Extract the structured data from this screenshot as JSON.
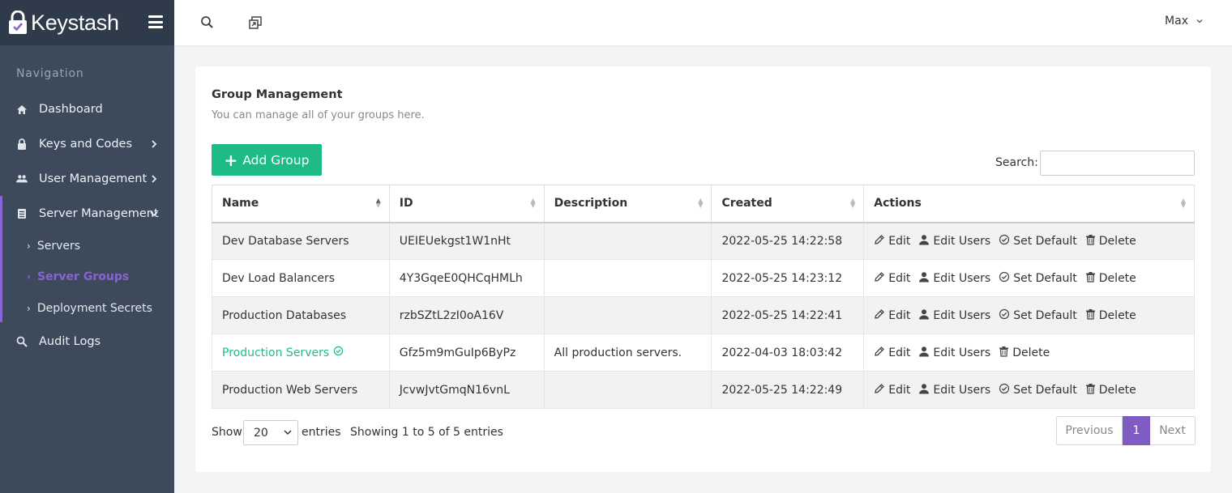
{
  "brand": {
    "name": "Keystash"
  },
  "sidebar": {
    "nav_title": "Navigation",
    "items": [
      {
        "label": "Dashboard",
        "icon": "home-icon"
      },
      {
        "label": "Keys and Codes",
        "icon": "lock-icon"
      },
      {
        "label": "User Management",
        "icon": "users-icon"
      },
      {
        "label": "Server Management",
        "icon": "server-icon"
      },
      {
        "label": "Audit Logs",
        "icon": "search-log-icon"
      }
    ],
    "sub_items": [
      {
        "label": "Servers"
      },
      {
        "label": "Server Groups"
      },
      {
        "label": "Deployment Secrets"
      }
    ]
  },
  "topbar": {
    "user_name": "Max"
  },
  "card": {
    "title": "Group Management",
    "subtitle": "You can manage all of your groups here.",
    "add_button": "Add Group",
    "search_label": "Search:"
  },
  "table": {
    "columns": [
      "Name",
      "ID",
      "Description",
      "Created",
      "Actions"
    ],
    "rows": [
      {
        "name": "Dev Database Servers",
        "id": "UEIEUekgst1W1nHt",
        "description": "",
        "created": "2022-05-25 14:22:58"
      },
      {
        "name": "Dev Load Balancers",
        "id": "4Y3GqeE0QHCqHMLh",
        "description": "",
        "created": "2022-05-25 14:23:12"
      },
      {
        "name": "Production Databases",
        "id": "rzbSZtL2zI0oA16V",
        "description": "",
        "created": "2022-05-25 14:22:41"
      },
      {
        "name": "Production Servers",
        "id": "Gfz5m9mGuIp6ByPz",
        "description": "All production servers.",
        "created": "2022-04-03 18:03:42"
      },
      {
        "name": "Production Web Servers",
        "id": "JcvwJvtGmqN16vnL",
        "description": "",
        "created": "2022-05-25 14:22:49"
      }
    ],
    "actions": {
      "edit": "Edit",
      "edit_users": "Edit Users",
      "set_default": "Set Default",
      "delete": "Delete"
    }
  },
  "footer": {
    "show_label": "Show",
    "page_size": "20",
    "entries_label": "entries",
    "info": "Showing 1 to 5 of 5 entries",
    "prev": "Previous",
    "page": "1",
    "next": "Next"
  },
  "colors": {
    "sidebar": "#3d4a5c",
    "accent": "#8a63d2",
    "success": "#1ebc84"
  }
}
